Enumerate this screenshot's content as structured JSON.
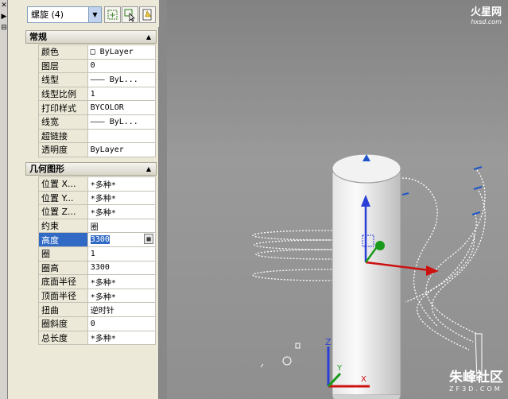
{
  "left_strip": {
    "glyphs": [
      "✕",
      "▶",
      "⊟"
    ]
  },
  "toolbar": {
    "object_selector": "螺旋 (4)",
    "buttons": [
      "toggle-pickadd-icon",
      "select-objects-icon",
      "quick-select-icon"
    ]
  },
  "sections": {
    "general": {
      "title": "常规",
      "rows": [
        {
          "name": "颜色",
          "value": "□ ByLayer"
        },
        {
          "name": "图层",
          "value": "0"
        },
        {
          "name": "线型",
          "value": "——— ByL..."
        },
        {
          "name": "线型比例",
          "value": "1"
        },
        {
          "name": "打印样式",
          "value": "BYCOLOR"
        },
        {
          "name": "线宽",
          "value": "——— ByL..."
        },
        {
          "name": "超链接",
          "value": ""
        },
        {
          "name": "透明度",
          "value": "ByLayer"
        }
      ]
    },
    "geometry": {
      "title": "几何图形",
      "rows": [
        {
          "name": "位置 X...",
          "value": "*多种*"
        },
        {
          "name": "位置 Y...",
          "value": "*多种*"
        },
        {
          "name": "位置 Z...",
          "value": "*多种*"
        },
        {
          "name": "约束",
          "value": "圈"
        },
        {
          "name": "高度",
          "value": "3300",
          "active": true
        },
        {
          "name": "圈",
          "value": "1"
        },
        {
          "name": "圈高",
          "value": "3300"
        },
        {
          "name": "底面半径",
          "value": "*多种*"
        },
        {
          "name": "顶面半径",
          "value": "*多种*"
        },
        {
          "name": "扭曲",
          "value": "逆时针"
        },
        {
          "name": "圈斜度",
          "value": "0"
        },
        {
          "name": "总长度",
          "value": "*多种*"
        }
      ]
    }
  },
  "viewport": {
    "logo_top": "火星网",
    "logo_top_sub": "hxsd.com",
    "watermark": "朱峰社区",
    "watermark_sub": "ZF3D.COM",
    "gizmo_colors": {
      "x": "#cc1111",
      "y": "#1a9a1a",
      "z": "#2b3fd8"
    }
  }
}
